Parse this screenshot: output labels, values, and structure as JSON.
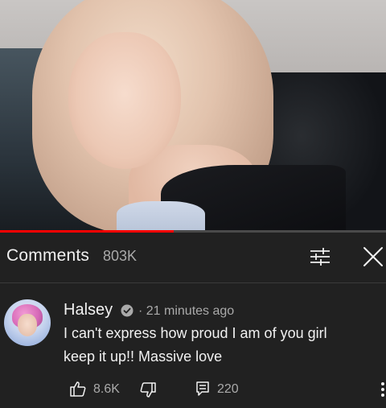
{
  "video": {
    "progress_fraction": 0.45,
    "colors": {
      "progress_track": "#4a4a4a",
      "progress_fill": "#ff0000"
    }
  },
  "comments_panel": {
    "title": "Comments",
    "count": "803K",
    "filter_icon": "sliders-icon",
    "close_icon": "close-icon"
  },
  "comment": {
    "author": "Halsey",
    "verified_icon": "verified-check-icon",
    "separator": "·",
    "timestamp": "21 minutes ago",
    "text": "I can't express how proud I am of you girl keep it up!!  Massive love",
    "likes": "8.6K",
    "replies": "220",
    "like_icon": "thumbs-up-icon",
    "dislike_icon": "thumbs-down-icon",
    "reply_icon": "reply-comment-icon",
    "more_icon": "more-vertical-icon"
  },
  "colors": {
    "background": "#212121",
    "text_primary": "#f1f1f1",
    "text_secondary": "#aaaaaa",
    "divider": "#3a3a3a"
  }
}
